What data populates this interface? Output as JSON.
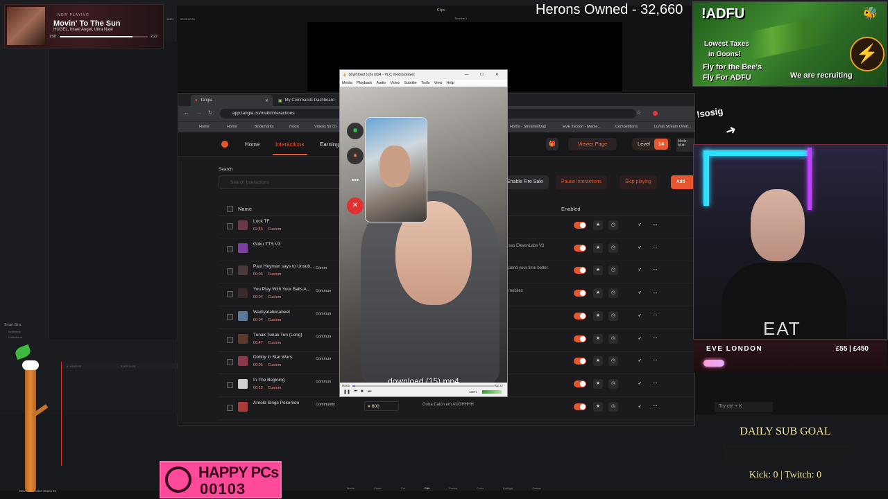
{
  "resolve": {
    "clips_label": "Clips",
    "timeline_label": "Timeline 1",
    "timecode": "00:00:00:01",
    "zoom": "186%",
    "ruler_start": "01:00:00:00",
    "ruler_mark2": "01:00:10:00",
    "tabs": [
      "Media",
      "Photo",
      "Cut",
      "Edit",
      "Fusion",
      "Color",
      "Fairlight",
      "Deliver"
    ],
    "footer": "DaVinci Resolve Studio 21",
    "smart_bins": "Smart Bins",
    "keywords": "Keywords",
    "collections": "Collections"
  },
  "now_playing": {
    "label": "NOW PLAYING",
    "title": "Movin' To The Sun",
    "artist": "HUGEL, Imael Angel, Ultra Naté",
    "elapsed": "1:58",
    "duration": "2:22",
    "progress": 0.83
  },
  "herons": "Herons Owned - 32,660",
  "adfu": {
    "title": "!ADFU",
    "line1": "Lowest Taxes",
    "line2": "in Goons!",
    "line3": "Fly for the Bee's",
    "line4": "Fly For ADFU",
    "recruiting": "We are recruiting",
    "badge_icon": "⚡",
    "bee_icon": "🐝"
  },
  "browser": {
    "tabs": [
      {
        "label": "Tangia",
        "icon": "tangia-icon"
      },
      {
        "label": "My Commands Dashboard",
        "icon": "dashboard-icon"
      }
    ],
    "url": "app.tangia.co/multi/interactions",
    "bookmarks": [
      "Home",
      "Home",
      "Bookmarks",
      "moon",
      "Videos for co",
      "Home - StreamerDap",
      "EVE Tycoon - Marke...",
      "Competitions",
      "Lumia Stream Overl..."
    ]
  },
  "tangia": {
    "nav": {
      "home": "Home",
      "interactions": "Interactions",
      "earnings": "Earning"
    },
    "viewer_page": "Viewer Page",
    "level_label": "Level",
    "level_value": "14",
    "mode_label": "Mode: Multi",
    "search_label": "Search",
    "search_placeholder": "Search Interactions",
    "enable_fire_sale": "Enable Fire Sale",
    "pause_interactions": "Pause Interactions",
    "skip_playing": "Skip playing",
    "add": "Add",
    "col_name": "Name",
    "col_enabled": "Enabled",
    "rows": [
      {
        "name": "Lock TF",
        "duration": "02:46",
        "tag": "Custom",
        "community": "",
        "desc": "",
        "cost": ""
      },
      {
        "name": "Goku TTS V3",
        "duration": "",
        "tag": "",
        "community": "",
        "desc": "ses ElevenLabs V3",
        "cost": ""
      },
      {
        "name": "Paul Heyman says to Unsub...",
        "duration": "00:06",
        "tag": "Custom",
        "community": "Comm",
        "desc": "pend your time better",
        "cost": ""
      },
      {
        "name": "You Play With Your Balls A...",
        "duration": "00:04",
        "tag": "Custom",
        "community": "Commun",
        "desc": "mobiles",
        "cost": ""
      },
      {
        "name": "Wadiyatalkinabeet",
        "duration": "00:04",
        "tag": "Custom",
        "community": "Commun",
        "desc": "",
        "cost": ""
      },
      {
        "name": "Tunak Tunak Tun (Long)",
        "duration": "00:47",
        "tag": "Custom",
        "community": "Commun",
        "desc": "",
        "cost": ""
      },
      {
        "name": "Dobby in Star Wars",
        "duration": "00:05",
        "tag": "Custom",
        "community": "Commun",
        "desc": "",
        "cost": ""
      },
      {
        "name": "In The Begining",
        "duration": "00:12",
        "tag": "Custom",
        "community": "Commun",
        "desc": "",
        "cost": ""
      },
      {
        "name": "Arnold Sings Pokemon",
        "duration": "",
        "tag": "",
        "community": "Community",
        "desc": "Gotta Catch em AUGHHHH",
        "cost": "600"
      }
    ]
  },
  "vlc": {
    "title": "download (15).mp4 - VLC media player",
    "menu": [
      "Media",
      "Playback",
      "Audio",
      "Video",
      "Subtitle",
      "Tools",
      "View",
      "Help"
    ],
    "caption": "download (15).mp4",
    "time_elapsed": "00:02",
    "time_total": "02:47",
    "progress": 0.02,
    "volume": "100%"
  },
  "sosig": "!sosig",
  "cam": {
    "shirt_text": "EAT",
    "name": "EVE LONDON",
    "money": "£55 | £450",
    "goal_progress": 0.12
  },
  "try_key": "Try ctrl + K",
  "daily_sub_goal": "DAILY SUB GOAL",
  "kick_twitch": "Kick: 0 | Twitch: 0",
  "happy": {
    "title": "HAPPY PCs",
    "number": "00103"
  },
  "colors": {
    "accent": "#e8552e",
    "neon_cyan": "#2fe0ff",
    "neon_purple": "#c040ff",
    "happy_pink": "#ff4a9a"
  }
}
